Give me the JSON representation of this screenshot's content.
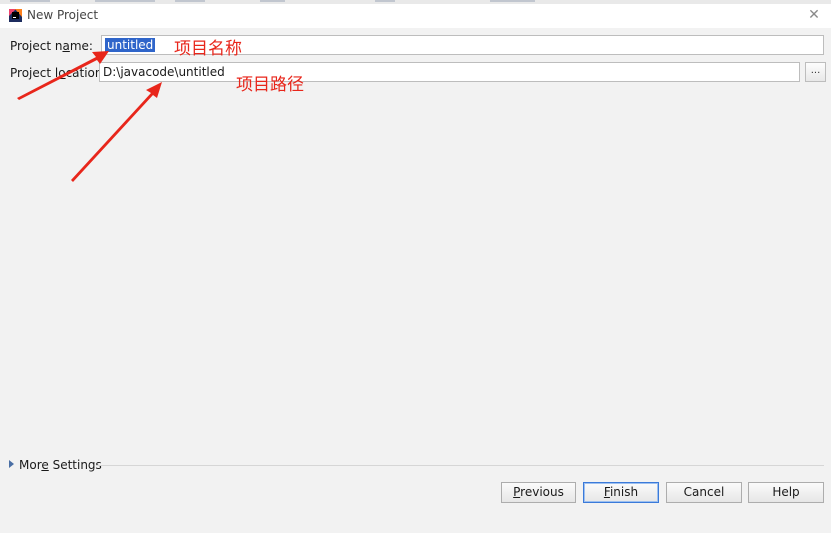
{
  "window": {
    "title": "New Project",
    "close_glyph": "✕"
  },
  "form": {
    "name_label": "Project name:",
    "name_value": "untitled",
    "location_label": "Project location:",
    "location_value": "D:\\javacode\\untitled",
    "browse_label": "..."
  },
  "annotations": {
    "name_note": "项目名称",
    "location_note": "项目路径",
    "color": "#e8261b"
  },
  "more_settings": {
    "label": "More Settings",
    "icon": "triangle-right-icon"
  },
  "buttons": {
    "previous": "Previous",
    "finish": "Finish",
    "cancel": "Cancel",
    "help": "Help"
  },
  "colors": {
    "selection": "#2f65ca",
    "dialog_bg": "#f2f2f2",
    "default_button_border": "#3b7ad9"
  }
}
